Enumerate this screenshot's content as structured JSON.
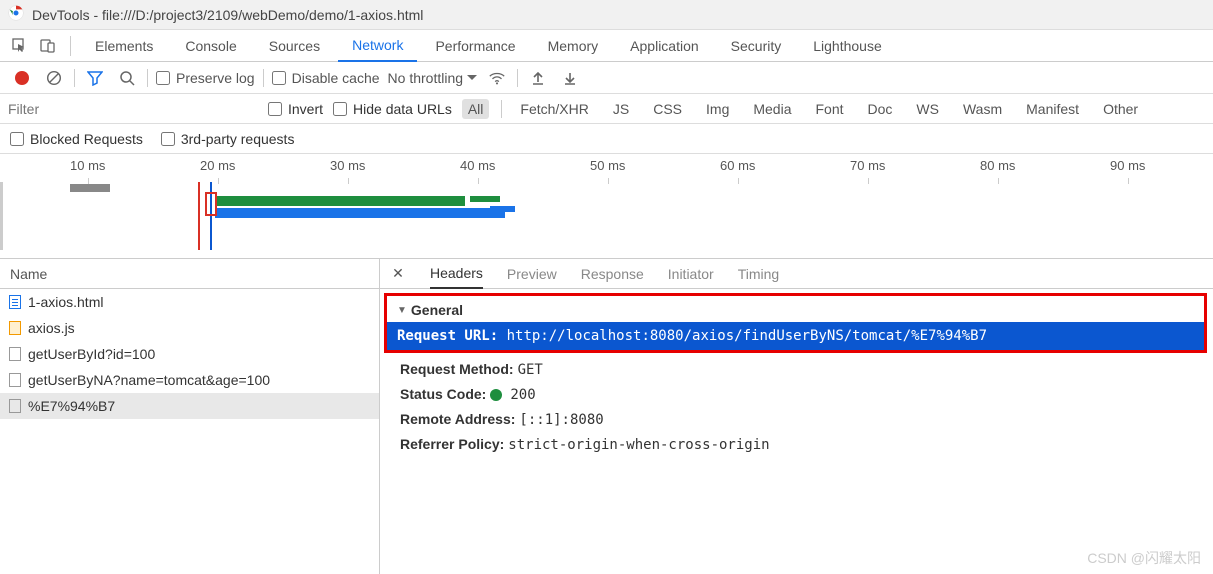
{
  "titlebar": {
    "title": "DevTools - file:///D:/project3/2109/webDemo/demo/1-axios.html"
  },
  "mainTabs": {
    "items": [
      "Elements",
      "Console",
      "Sources",
      "Network",
      "Performance",
      "Memory",
      "Application",
      "Security",
      "Lighthouse"
    ],
    "active": "Network"
  },
  "toolbar": {
    "preserveLog": "Preserve log",
    "disableCache": "Disable cache",
    "throttle": "No throttling"
  },
  "filterRow": {
    "placeholder": "Filter",
    "invert": "Invert",
    "hideData": "Hide data URLs",
    "types": [
      "All",
      "Fetch/XHR",
      "JS",
      "CSS",
      "Img",
      "Media",
      "Font",
      "Doc",
      "WS",
      "Wasm",
      "Manifest",
      "Other"
    ],
    "activeType": "All"
  },
  "blockedRow": {
    "blocked": "Blocked Requests",
    "thirdParty": "3rd-party requests"
  },
  "timeline": {
    "ticks": [
      "10 ms",
      "20 ms",
      "30 ms",
      "40 ms",
      "50 ms",
      "60 ms",
      "70 ms",
      "80 ms",
      "90 ms"
    ]
  },
  "requestList": {
    "header": "Name",
    "items": [
      {
        "name": "1-axios.html",
        "icon": "file-blue"
      },
      {
        "name": "axios.js",
        "icon": "file-orange"
      },
      {
        "name": "getUserById?id=100",
        "icon": "file-gray"
      },
      {
        "name": "getUserByNA?name=tomcat&age=100",
        "icon": "file-gray"
      },
      {
        "name": "%E7%94%B7",
        "icon": "file-gray"
      }
    ],
    "selectedIndex": 4
  },
  "detailTabs": {
    "items": [
      "Headers",
      "Preview",
      "Response",
      "Initiator",
      "Timing"
    ],
    "active": "Headers"
  },
  "general": {
    "section": "General",
    "requestUrl": {
      "label": "Request URL:",
      "value": "http://localhost:8080/axios/findUserByNS/tomcat/%E7%94%B7"
    },
    "method": {
      "label": "Request Method:",
      "value": "GET"
    },
    "status": {
      "label": "Status Code:",
      "value": "200"
    },
    "remote": {
      "label": "Remote Address:",
      "value": "[::1]:8080"
    },
    "referrer": {
      "label": "Referrer Policy:",
      "value": "strict-origin-when-cross-origin"
    }
  },
  "watermark": "CSDN @闪耀太阳"
}
